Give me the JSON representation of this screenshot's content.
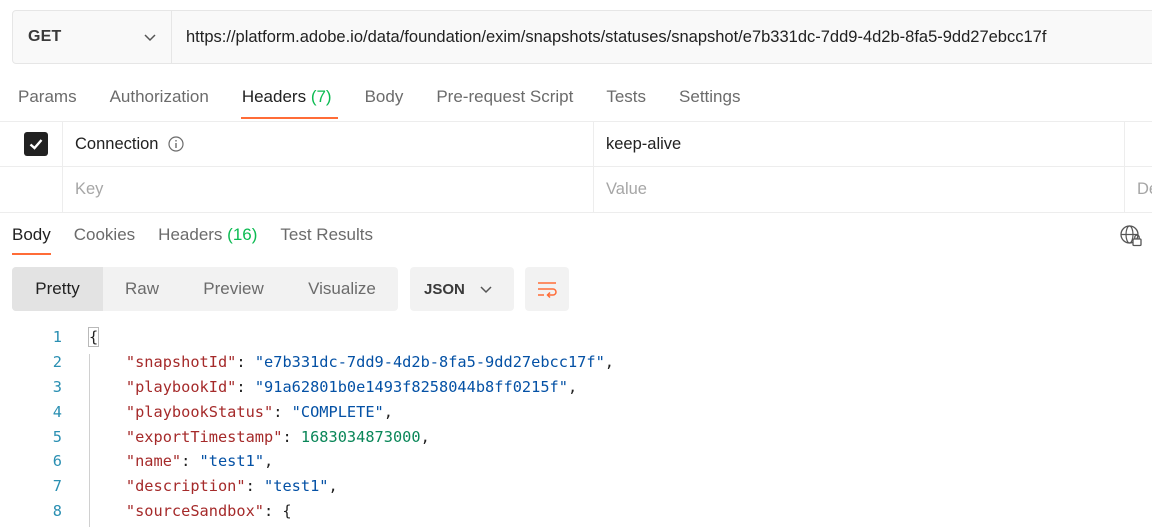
{
  "request": {
    "method": "GET",
    "url": "https://platform.adobe.io/data/foundation/exim/snapshots/statuses/snapshot/e7b331dc-7dd9-4d2b-8fa5-9dd27ebcc17f"
  },
  "request_tabs": [
    {
      "label": "Params"
    },
    {
      "label": "Authorization"
    },
    {
      "label": "Headers",
      "count": "(7)"
    },
    {
      "label": "Body"
    },
    {
      "label": "Pre-request Script"
    },
    {
      "label": "Tests"
    },
    {
      "label": "Settings"
    }
  ],
  "headers_table": {
    "rows": [
      {
        "checked": true,
        "key": "Connection",
        "value": "keep-alive"
      }
    ],
    "new_row": {
      "key_placeholder": "Key",
      "value_placeholder": "Value",
      "description_placeholder": "De"
    }
  },
  "response_tabs": [
    {
      "label": "Body"
    },
    {
      "label": "Cookies"
    },
    {
      "label": "Headers",
      "count": "(16)"
    },
    {
      "label": "Test Results"
    }
  ],
  "view_modes": [
    "Pretty",
    "Raw",
    "Preview",
    "Visualize"
  ],
  "format": "JSON",
  "code_lines": [
    {
      "n": "1"
    },
    {
      "n": "2",
      "key": "snapshotId",
      "value": "e7b331dc-7dd9-4d2b-8fa5-9dd27ebcc17f"
    },
    {
      "n": "3",
      "key": "playbookId",
      "value": "91a62801b0e1493f8258044b8ff0215f"
    },
    {
      "n": "4",
      "key": "playbookStatus",
      "value": "COMPLETE"
    },
    {
      "n": "5",
      "key": "exportTimestamp",
      "value": "1683034873000"
    },
    {
      "n": "6",
      "key": "name",
      "value": "test1"
    },
    {
      "n": "7",
      "key": "description",
      "value": "test1"
    },
    {
      "n": "8",
      "key": "sourceSandbox"
    }
  ],
  "colors": {
    "accent": "#ff6c37",
    "count": "#0cbb52",
    "key": "#a52a2a",
    "string": "#0451a5",
    "number": "#098658",
    "line_number": "#2a8fb2"
  }
}
